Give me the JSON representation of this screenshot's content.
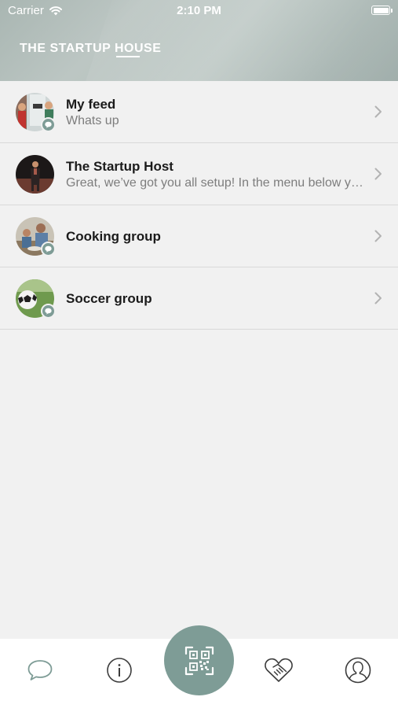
{
  "status_bar": {
    "carrier": "Carrier",
    "time": "2:10 PM",
    "battery_level": 1.0
  },
  "header": {
    "title": "THE STARTUP HOUSE"
  },
  "conversations": [
    {
      "title": "My feed",
      "subtitle": "Whats up",
      "avatar": "feed-photo",
      "group_badge": true
    },
    {
      "title": "The Startup Host",
      "subtitle": "Great, we’ve got you all setup! In the menu below you’ll find everything",
      "avatar": "host-photo",
      "group_badge": false
    },
    {
      "title": "Cooking group",
      "subtitle": "",
      "avatar": "cooking-photo",
      "group_badge": true
    },
    {
      "title": "Soccer group",
      "subtitle": "",
      "avatar": "soccer-photo",
      "group_badge": true
    }
  ],
  "tabbar": {
    "items": [
      {
        "icon": "chat-bubble-icon",
        "active": true
      },
      {
        "icon": "info-icon",
        "active": false
      },
      {
        "icon": "qr-code-icon",
        "active": false,
        "primary": true
      },
      {
        "icon": "handshake-heart-icon",
        "active": false
      },
      {
        "icon": "profile-icon",
        "active": false
      }
    ]
  },
  "colors": {
    "accent": "#7e9c96",
    "background": "#f1f1f1",
    "title_text": "#1b1b1b",
    "subtitle_text": "#7d7d7d"
  }
}
